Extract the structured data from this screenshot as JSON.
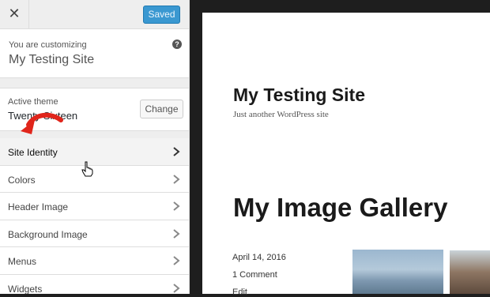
{
  "customizer": {
    "close_glyph": "✕",
    "save_label": "Saved",
    "customizing_label": "You are customizing",
    "site_name": "My Testing Site",
    "help_glyph": "?",
    "active_theme_label": "Active theme",
    "theme_name": "Twenty Sixteen",
    "change_label": "Change",
    "menu_items": [
      {
        "label": "Site Identity"
      },
      {
        "label": "Colors"
      },
      {
        "label": "Header Image"
      },
      {
        "label": "Background Image"
      },
      {
        "label": "Menus"
      },
      {
        "label": "Widgets"
      }
    ]
  },
  "preview": {
    "site_title": "My Testing Site",
    "tagline": "Just another WordPress site",
    "post_title": "My Image Gallery",
    "post_date": "April 14, 2016",
    "comments": "1 Comment",
    "edit": "Edit"
  },
  "colors": {
    "save_button": "#3a98d1",
    "annotation_arrow": "#e0251b"
  }
}
